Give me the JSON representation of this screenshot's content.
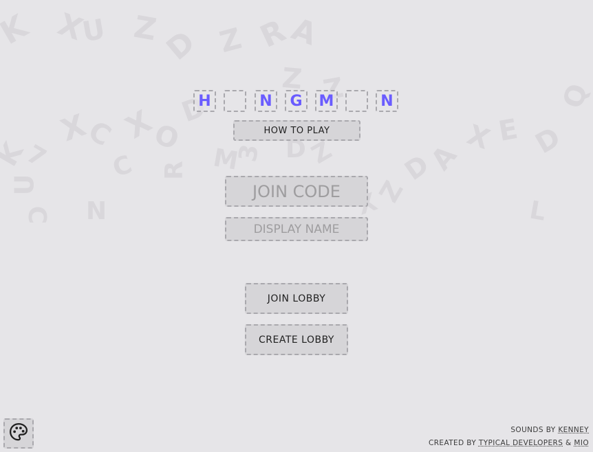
{
  "title": {
    "tiles": [
      "H",
      "",
      "N",
      "G",
      "M",
      "",
      "N"
    ]
  },
  "buttons": {
    "how_to_play": "how to play",
    "join_lobby": "join lobby",
    "create_lobby": "create lobby"
  },
  "inputs": {
    "join_code_placeholder": "join code",
    "display_name_placeholder": "display name"
  },
  "credits": {
    "sounds_prefix": "sounds by",
    "sounds_author": "Kenney",
    "created_prefix": "created by",
    "created_author1": "Typical Developers",
    "amp": "&",
    "created_author2": "Mio"
  },
  "icons": {
    "theme": "palette-icon"
  },
  "colors": {
    "background": "#e6e5e8",
    "accent_letters": "#6a5cff",
    "button_bg": "#d6d5d8"
  }
}
